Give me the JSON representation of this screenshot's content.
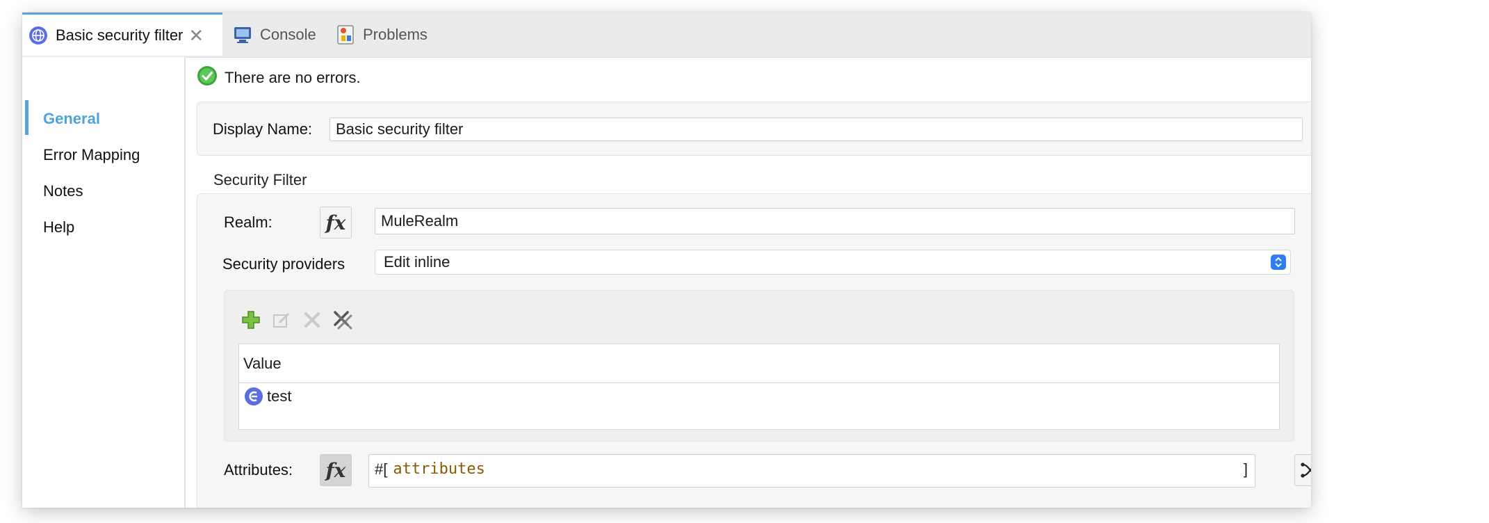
{
  "tabs": [
    {
      "label": "Basic security filter",
      "icon": "globe-icon",
      "active": true,
      "closable": true
    },
    {
      "label": "Console",
      "icon": "console-icon",
      "active": false
    },
    {
      "label": "Problems",
      "icon": "problems-icon",
      "active": false
    }
  ],
  "sidebar": {
    "items": [
      {
        "label": "General",
        "active": true
      },
      {
        "label": "Error Mapping"
      },
      {
        "label": "Notes"
      },
      {
        "label": "Help"
      }
    ]
  },
  "status": {
    "message": "There are no errors.",
    "icon": "check-circle-icon"
  },
  "general": {
    "display_name_label": "Display Name:",
    "display_name_value": "Basic security filter"
  },
  "security_filter": {
    "section_title": "Security Filter",
    "realm_label": "Realm:",
    "realm_value": "MuleRealm",
    "providers_label": "Security providers",
    "providers_selected": "Edit inline",
    "toolbar": [
      "add-icon",
      "edit-icon",
      "delete-icon",
      "delete-all-icon"
    ],
    "table": {
      "columns": [
        "Value"
      ],
      "rows": [
        {
          "value": "test",
          "icon": "expression-icon"
        }
      ]
    },
    "attributes_label": "Attributes:",
    "attributes_prefix": "#[",
    "attributes_value": "attributes",
    "attributes_suffix": "]"
  },
  "fx_label": "fx",
  "colors": {
    "accent": "#4fa3d6",
    "select_arrow": "#2f7cf6",
    "success": "#3aa53a",
    "expression_text": "#8a5a00"
  }
}
